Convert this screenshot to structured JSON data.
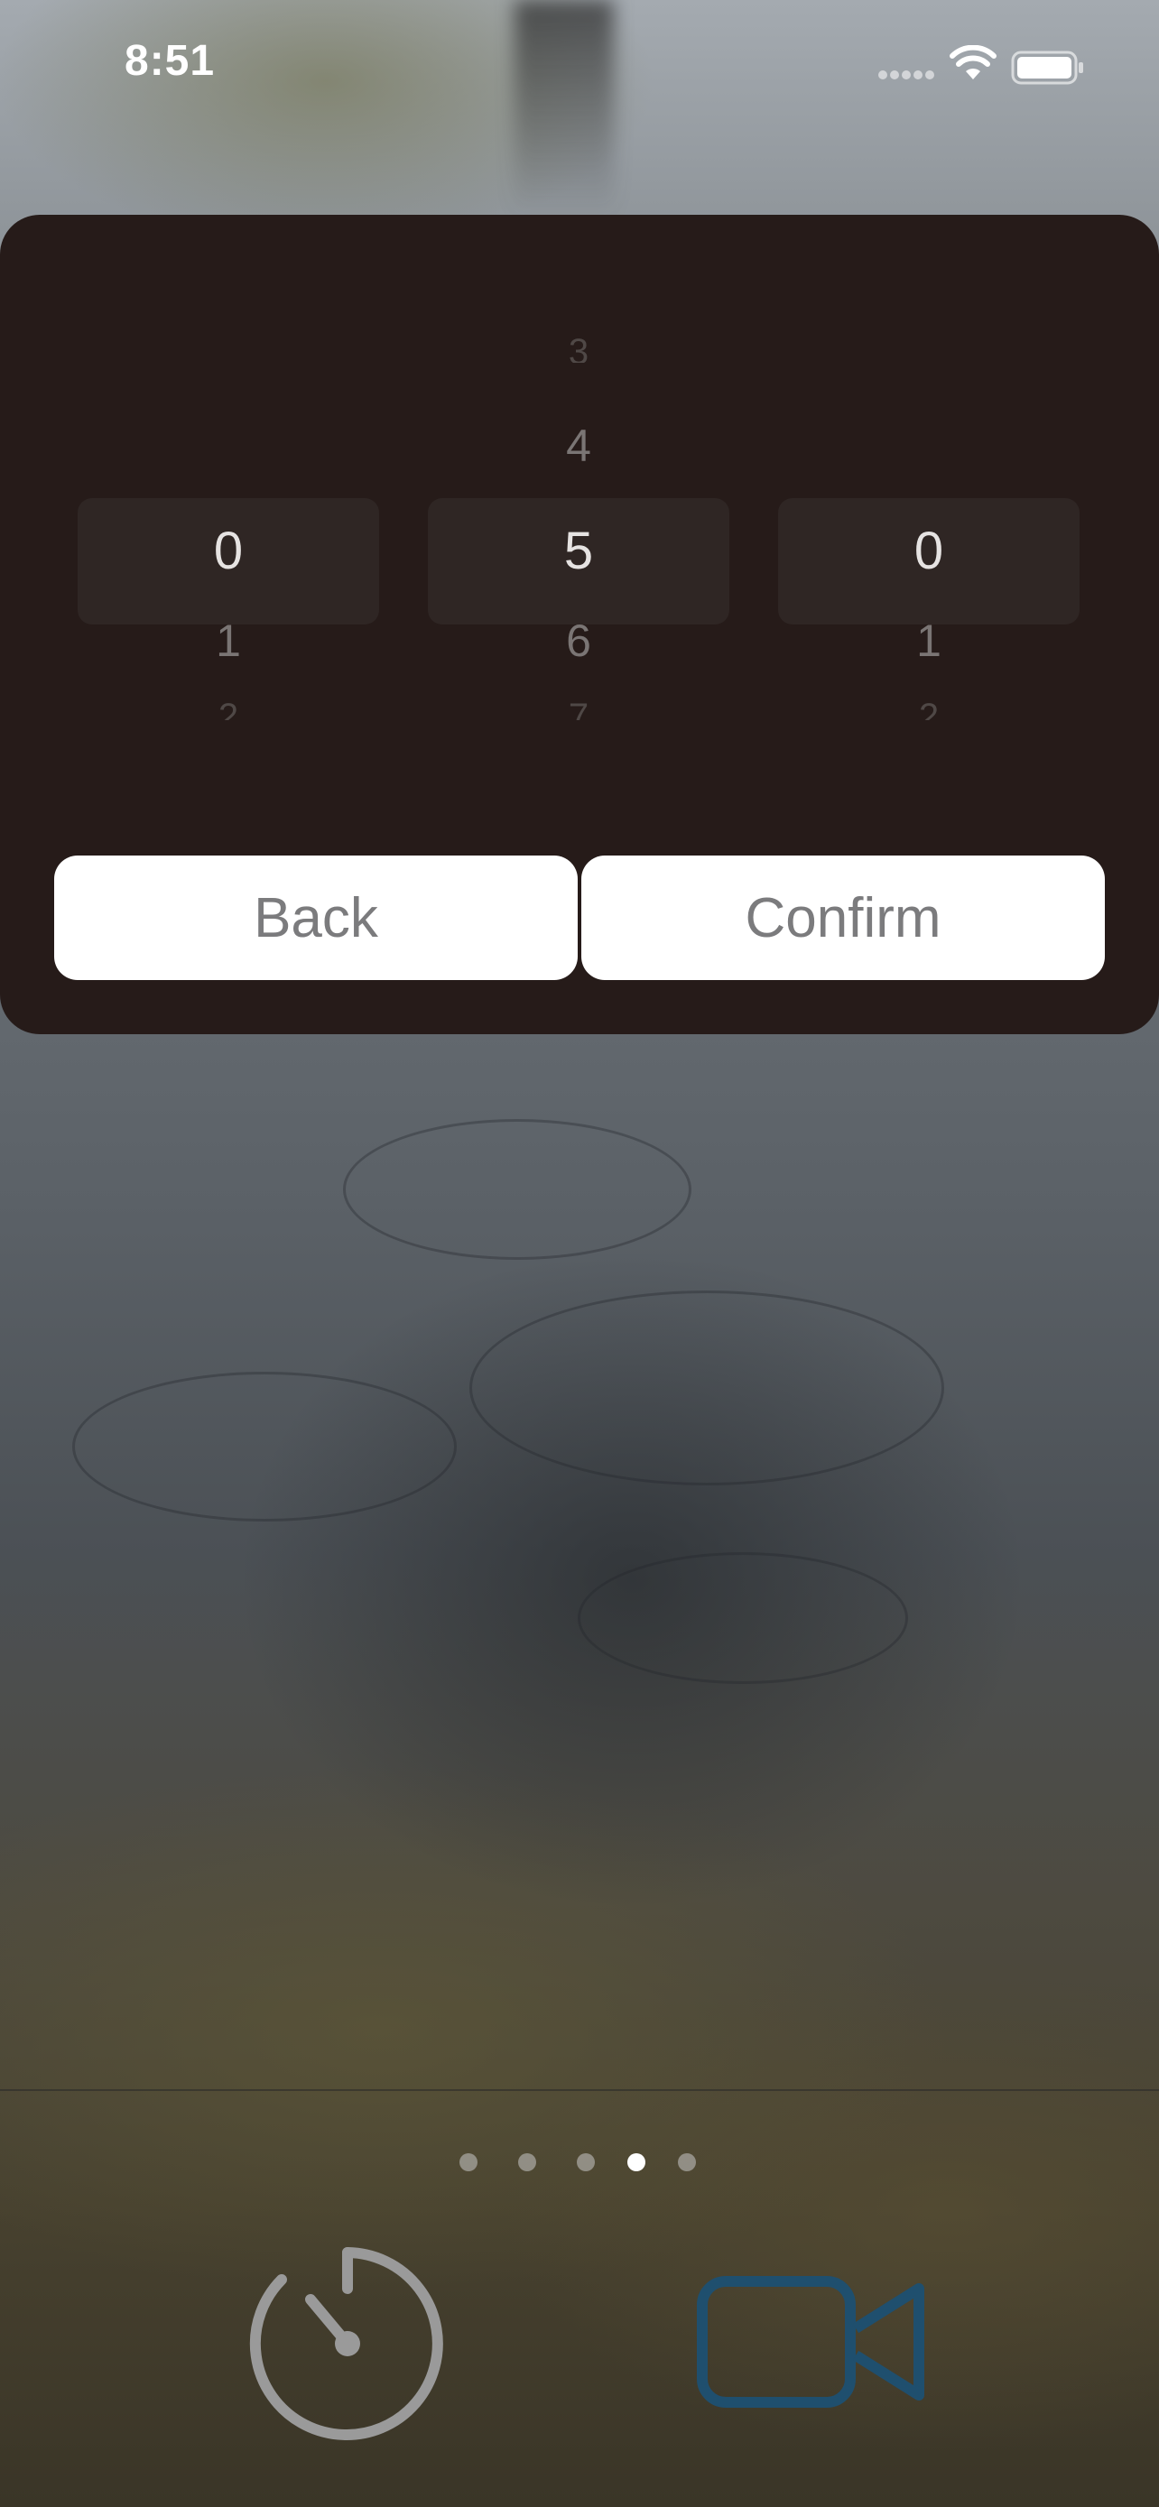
{
  "status_bar": {
    "time": "8:51",
    "icons": [
      "signal-icon",
      "wifi-icon",
      "battery-icon"
    ]
  },
  "picker": {
    "columns": [
      {
        "selected": "0",
        "above2": "",
        "above1": "",
        "below1": "1",
        "below2": "2"
      },
      {
        "selected": "5",
        "above2": "3",
        "above1": "4",
        "below1": "6",
        "below2": "7"
      },
      {
        "selected": "0",
        "above2": "",
        "above1": "",
        "below1": "1",
        "below2": "2"
      }
    ]
  },
  "actions": {
    "back_label": "Back",
    "confirm_label": "Confirm"
  },
  "pager": {
    "total": 5,
    "active_index": 3
  },
  "bottom_bar": {
    "icons": [
      "timer-icon",
      "video-camera-icon"
    ]
  },
  "colors": {
    "panel_bg": "#261b19",
    "selection_bg": "#2f2624",
    "button_bg": "#ffffff",
    "button_text": "#7b7b7d",
    "video_icon": "#1f4f6e",
    "timer_icon": "#9a9a9a"
  }
}
